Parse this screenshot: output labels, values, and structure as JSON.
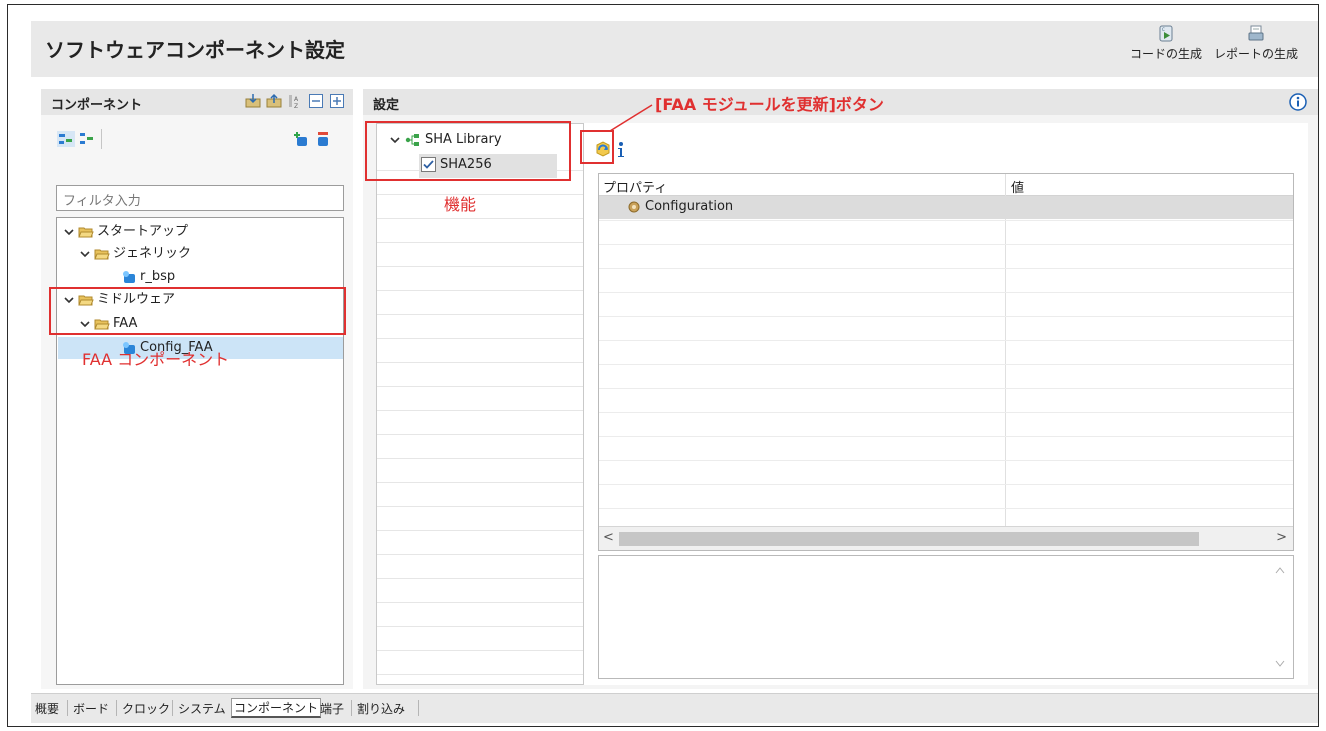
{
  "window": {
    "title": "ソフトウェアコンポーネント設定",
    "generate_code_label": "コードの生成",
    "generate_report_label": "レポートの生成"
  },
  "components_panel": {
    "header": "コンポーネント",
    "filter_placeholder": "フィルタ入力",
    "tree": [
      {
        "label": "スタートアップ",
        "level": 0,
        "type": "folder"
      },
      {
        "label": "ジェネリック",
        "level": 1,
        "type": "folder"
      },
      {
        "label": "r_bsp",
        "level": 2,
        "type": "component"
      },
      {
        "label": "ミドルウェア",
        "level": 0,
        "type": "folder"
      },
      {
        "label": "FAA",
        "level": 1,
        "type": "folder"
      },
      {
        "label": "Config_FAA",
        "level": 2,
        "type": "component",
        "selected": true
      }
    ]
  },
  "settings_panel": {
    "header": "設定",
    "function_tree": {
      "library": "SHA Library",
      "function": "SHA256",
      "function_checked": true
    },
    "property_table": {
      "columns": [
        "プロパティ",
        "値"
      ],
      "rows": [
        {
          "property": "Configuration",
          "value": ""
        }
      ]
    }
  },
  "annotations": {
    "faa_component": "FAA コンポーネント",
    "function": "機能",
    "update_button": "[FAA モジュールを更新]ボタン"
  },
  "tabs": [
    "概要",
    "ボード",
    "クロック",
    "システム",
    "コンポーネント",
    "端子",
    "割り込み"
  ],
  "active_tab": "コンポーネント",
  "colors": {
    "annotation_red": "#e03030",
    "selection_blue": "#cce4f7",
    "info_blue": "#1a5fb4"
  }
}
